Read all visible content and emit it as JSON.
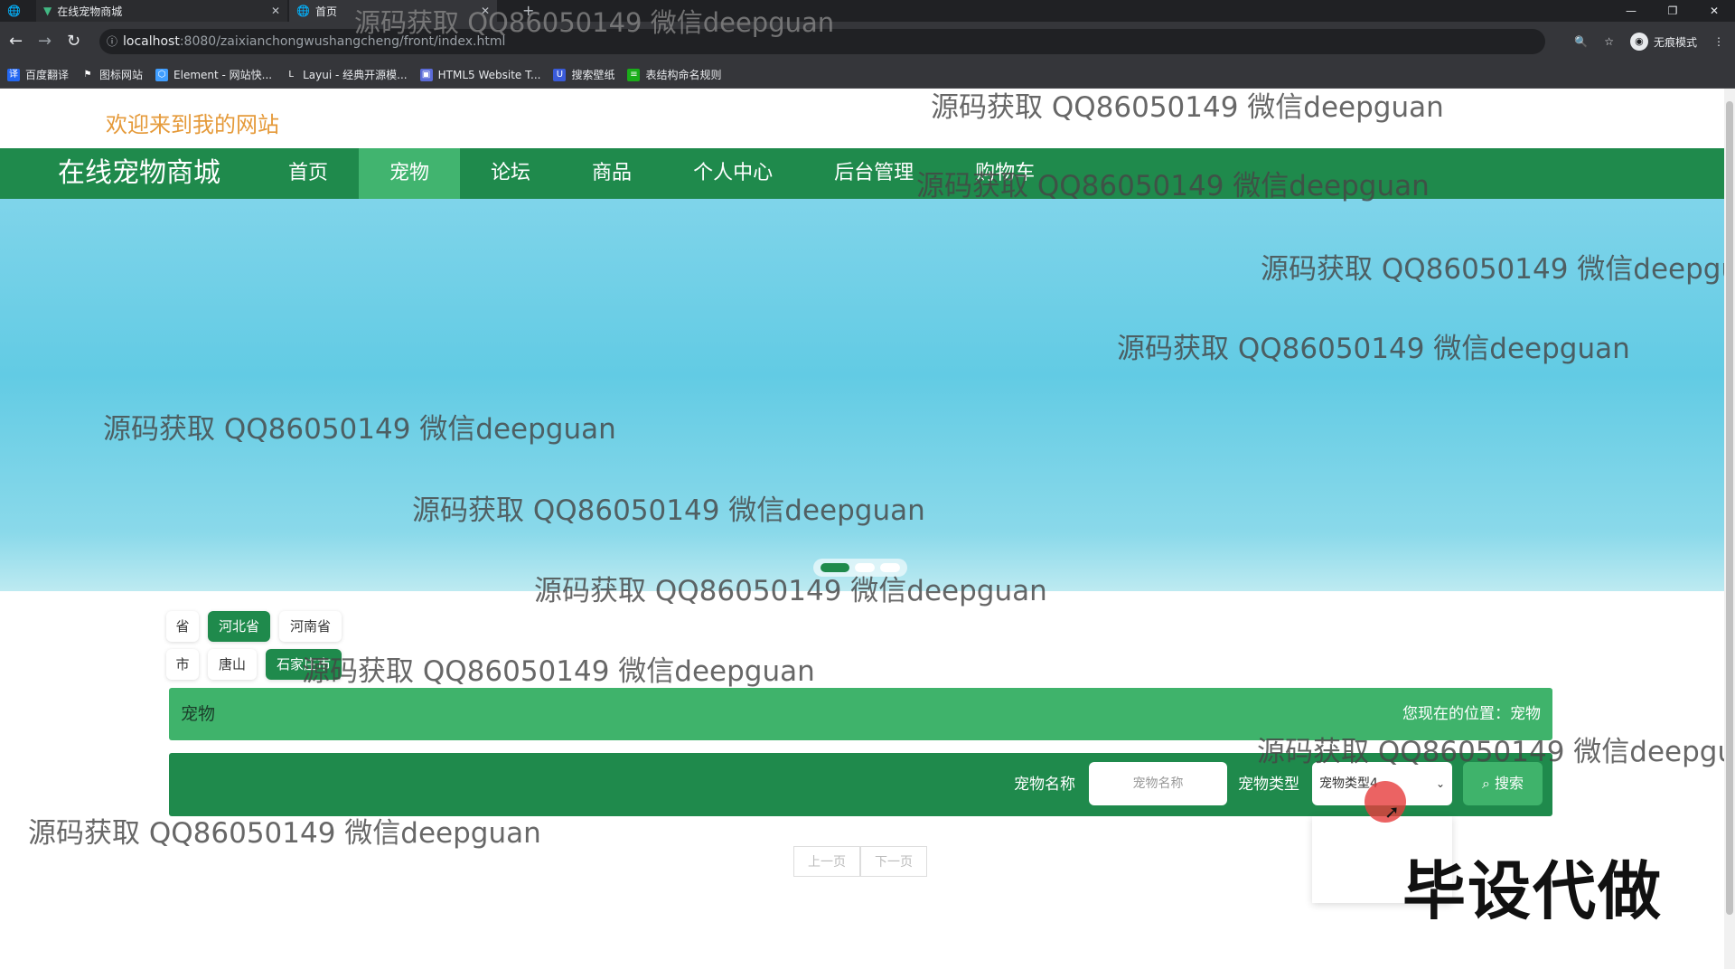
{
  "browser": {
    "tabs": [
      {
        "title": ""
      },
      {
        "title": "在线宠物商城"
      },
      {
        "title": "首页"
      }
    ],
    "url_host": "localhost",
    "url_path": ":8080/zaixianchongwushangcheng/front/index.html",
    "incognito_label": "无痕模式",
    "bookmarks": [
      {
        "label": "百度翻译",
        "color": "#2468f2"
      },
      {
        "label": "图标网站",
        "color": "#ffffff"
      },
      {
        "label": "Element - 网站快...",
        "color": "#409eff"
      },
      {
        "label": "Layui - 经典开源模...",
        "color": "#ffffff"
      },
      {
        "label": "HTML5 Website T...",
        "color": "#5b6bd8"
      },
      {
        "label": "搜索壁纸",
        "color": "#3a5bd9"
      },
      {
        "label": "表结构命名规则",
        "color": "#1aad19"
      }
    ]
  },
  "site": {
    "welcome": "欢迎来到我的网站",
    "brand": "在线宠物商城",
    "nav": [
      "首页",
      "宠物",
      "论坛",
      "商品",
      "个人中心",
      "后台管理",
      "购物车"
    ],
    "active_nav": "宠物"
  },
  "filters": {
    "province_label": "省",
    "provinces": [
      "河北省",
      "河南省"
    ],
    "selected_province": "河北省",
    "city_label": "市",
    "cities": [
      "唐山",
      "石家庄市"
    ],
    "selected_city": "石家庄市"
  },
  "section": {
    "title": "宠物",
    "breadcrumb": "您现在的位置：宠物"
  },
  "search": {
    "name_label": "宠物名称",
    "name_placeholder": "宠物名称",
    "type_label": "宠物类型",
    "type_value": "宠物类型4",
    "button": "搜索"
  },
  "pager": {
    "prev": "上一页",
    "next": "下一页"
  },
  "overlay": "毕设代做",
  "watermark": "源码获取 QQ86050149 微信deepguan",
  "colors": {
    "primary": "#1f8a4c",
    "accent": "#3fb36b",
    "welcome": "#e59a3a"
  }
}
